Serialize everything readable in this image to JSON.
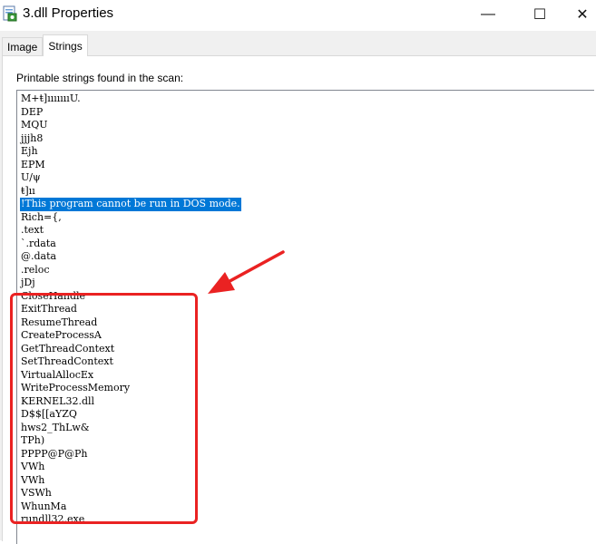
{
  "window": {
    "title": "3.dll Properties",
    "minimize_glyph": "—",
    "maximize_glyph": "☐",
    "close_glyph": "✕"
  },
  "tabs": [
    {
      "label": "Image",
      "active": false
    },
    {
      "label": "Strings",
      "active": true
    }
  ],
  "panel": {
    "caption": "Printable strings found in the scan:"
  },
  "strings": [
    "M+ŧ]ıııııııU.",
    "DEP",
    "MQU",
    "jjjh8",
    "Ejh",
    "EPM",
    "U/ψ",
    "ŧ]ıı",
    "!This program cannot be run in DOS mode.",
    "Rich={,",
    ".text",
    "`.rdata",
    "@.data",
    ".reloc",
    "jDj",
    "CloseHandle",
    "ExitThread",
    "ResumeThread",
    "CreateProcessA",
    "GetThreadContext",
    "SetThreadContext",
    "VirtualAllocEx",
    "WriteProcessMemory",
    "KERNEL32.dll",
    "D$$[[aYZQ",
    "hws2_ThLw&",
    "TPh)",
    "PPPP@P@Ph",
    "VWh",
    "VWh",
    "VSWh",
    "WhunMa",
    "rundll32.exe"
  ],
  "selected_index": 8,
  "annotation": {
    "color": "#ea2222"
  },
  "colors": {
    "selection": "#0078d7",
    "tab_border": "#d9d9d9",
    "list_border": "#828790"
  }
}
